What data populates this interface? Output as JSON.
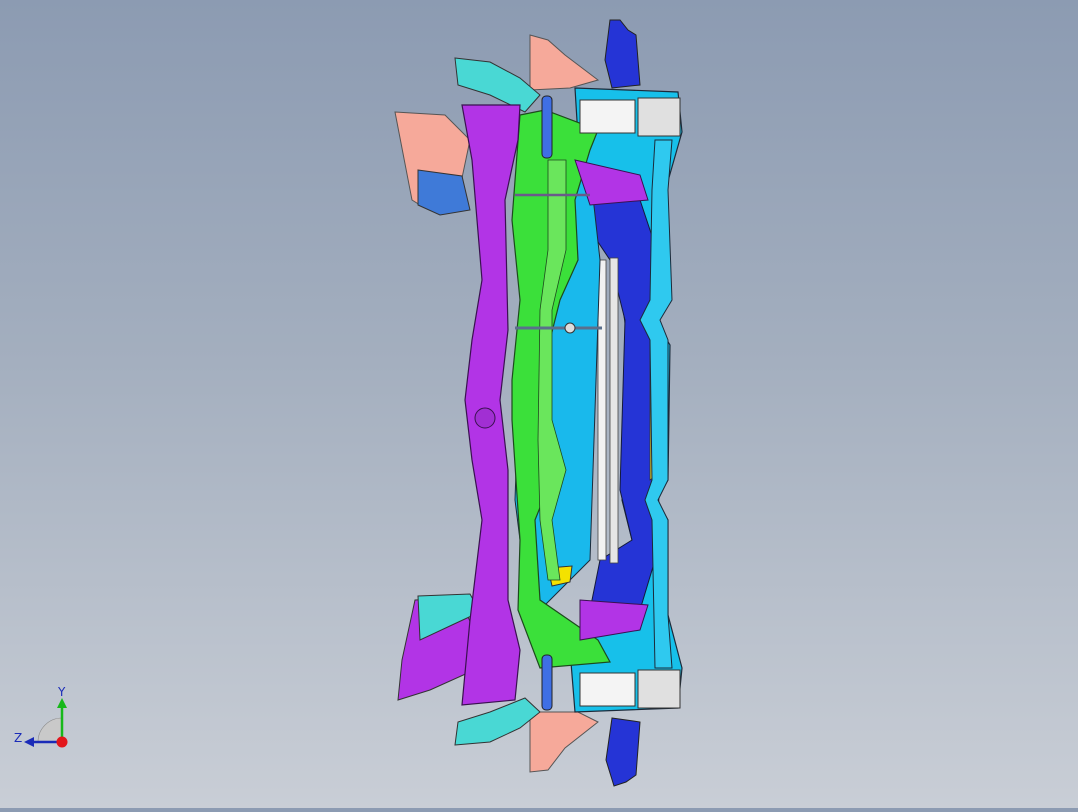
{
  "viewport": {
    "background_top": "#8c9bb2",
    "background_bottom": "#c9ced6",
    "model_colors": {
      "magenta": "#b234e6",
      "green": "#3be03a",
      "cyan": "#17c0ea",
      "blue": "#2534d6",
      "salmon": "#f6a99a",
      "yellow": "#f4e200",
      "white": "#f2f2f2",
      "teal": "#49d8d4"
    }
  },
  "triad": {
    "y_label": "Y",
    "z_label": "Z",
    "x_color": "#e3161b",
    "y_color": "#17b81a",
    "z_color": "#1a2bb8"
  }
}
